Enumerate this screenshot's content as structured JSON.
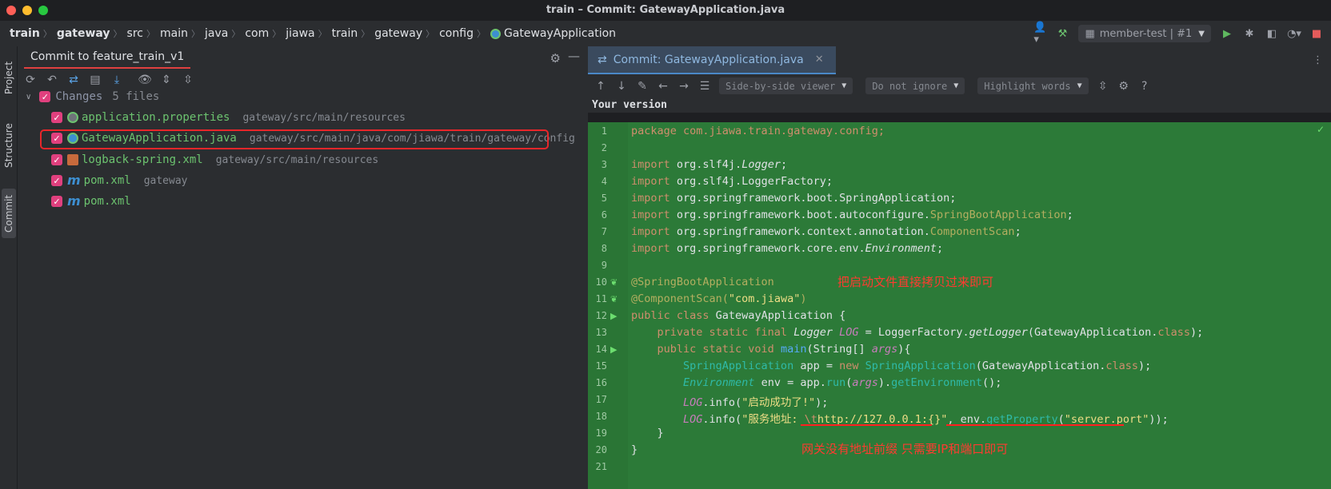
{
  "window": {
    "title": "train – Commit: GatewayApplication.java"
  },
  "breadcrumb": [
    "train",
    "gateway",
    "src",
    "main",
    "java",
    "com",
    "jiawa",
    "train",
    "gateway",
    "config",
    "GatewayApplication"
  ],
  "run_config": {
    "label": "member-test | #1"
  },
  "left_strip": {
    "project": "Project",
    "structure": "Structure",
    "commit": "Commit"
  },
  "commit": {
    "tab_title": "Commit to feature_train_v1",
    "changes_label": "Changes",
    "changes_count": "5 files",
    "files": [
      {
        "name": "application.properties",
        "path": "gateway/src/main/resources",
        "icon": "properties-icon"
      },
      {
        "name": "GatewayApplication.java",
        "path": "gateway/src/main/java/com/jiawa/train/gateway/config",
        "icon": "java-class-icon"
      },
      {
        "name": "logback-spring.xml",
        "path": "gateway/src/main/resources",
        "icon": "xml-icon"
      },
      {
        "name": "pom.xml",
        "path": "gateway",
        "icon": "maven-icon"
      },
      {
        "name": "pom.xml",
        "path": "",
        "icon": "maven-icon"
      }
    ]
  },
  "diff": {
    "tab_label": "Commit: GatewayApplication.java",
    "viewer": "Side-by-side viewer",
    "ignore": "Do not ignore",
    "highlight": "Highlight words",
    "help": "?",
    "version_label": "Your version",
    "line_numbers": [
      "1",
      "2",
      "3",
      "4",
      "5",
      "6",
      "7",
      "8",
      "9",
      "10",
      "11",
      "12",
      "13",
      "14",
      "15",
      "16",
      "17",
      "18",
      "19",
      "20",
      "21"
    ],
    "code": {
      "l1": "package com.jiawa.train.gateway.config;",
      "l3a": "import ",
      "l3b": "org.slf4j.",
      "l3c": "Logger",
      "l3d": ";",
      "l4a": "import ",
      "l4b": "org.slf4j.LoggerFactory;",
      "l5a": "import ",
      "l5b": "org.springframework.boot.SpringApplication;",
      "l6a": "import ",
      "l6b": "org.springframework.boot.autoconfigure.",
      "l6c": "SpringBootApplication",
      "l6d": ";",
      "l7a": "import ",
      "l7b": "org.springframework.context.annotation.",
      "l7c": "ComponentScan",
      "l7d": ";",
      "l8a": "import ",
      "l8b": "org.springframework.core.env.",
      "l8c": "Environment",
      "l8d": ";",
      "l10": "@SpringBootApplication",
      "l11a": "@ComponentScan(",
      "l11b": "\"com.jiawa\"",
      "l11c": ")",
      "l12a": "public class ",
      "l12b": "GatewayApplication {",
      "l13a": "    private static final ",
      "l13b": "Logger",
      "l13c": " LOG",
      "l13d": " = LoggerFactory.",
      "l13e": "getLogger",
      "l13f": "(GatewayApplication.",
      "l13g": "class",
      "l13h": ");",
      "l14a": "    public static void ",
      "l14b": "main",
      "l14c": "(String[] ",
      "l14d": "args",
      "l14e": "){",
      "l15a": "        SpringApplication",
      "l15b": " app = ",
      "l15c": "new ",
      "l15d": "SpringApplication",
      "l15e": "(GatewayApplication.",
      "l15f": "class",
      "l15g": ");",
      "l16a": "        Environment",
      "l16b": " env = app.",
      "l16c": "run",
      "l16d": "(",
      "l16e": "args",
      "l16f": ").",
      "l16g": "getEnvironment",
      "l16h": "();",
      "l17a": "        LOG",
      "l17b": ".info(",
      "l17c": "\"启动成功了!\"",
      "l17d": ");",
      "l18a": "        LOG",
      "l18b": ".info(",
      "l18c": "\"服务地址: ",
      "l18d": "\\t",
      "l18e": "http://127.0.0.1:{}\"",
      "l18f": ", env.",
      "l18g": "getProperty",
      "l18h": "(",
      "l18i": "\"server.port\"",
      "l18j": "));",
      "l19": "    }",
      "l20": "}"
    },
    "annotations": {
      "note1": "把启动文件直接拷贝过来即可",
      "note2": "网关没有地址前缀 只需要IP和端口即可"
    }
  }
}
